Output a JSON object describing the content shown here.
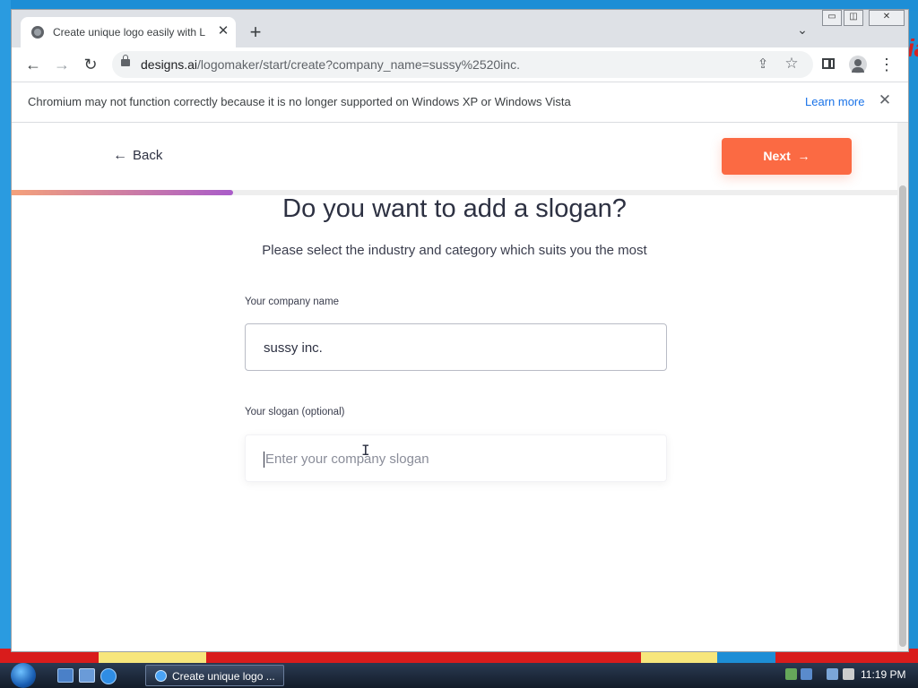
{
  "desktop": {
    "edge_text": "ia"
  },
  "browser": {
    "tab": {
      "title": "Create unique logo easily with Lo",
      "close": "✕"
    },
    "new_tab": "+",
    "tab_list": "⌄",
    "window_controls": {
      "minimize": "▭",
      "maximize": "◫",
      "close": "✕"
    },
    "nav": {
      "back": "←",
      "forward": "→",
      "reload": "↻"
    },
    "address": {
      "domain": "designs.ai",
      "path": "/logomaker/start/create?company_name=sussy%2520inc."
    },
    "menu": "⋮",
    "infobar": {
      "message": "Chromium may not function correctly because it is no longer supported on Windows XP or Windows Vista",
      "learn_more": "Learn more",
      "close": "✕"
    }
  },
  "page": {
    "back_label": "Back",
    "next_label": "Next",
    "progress": 0.25,
    "heading": "Do you want to add a slogan?",
    "subheading": "Please select the industry and category which suits you the most",
    "company_label": "Your company name",
    "company_value": "sussy inc.",
    "slogan_label": "Your slogan (optional)",
    "slogan_placeholder": "Enter your company slogan"
  },
  "taskbar": {
    "task_label": "Create unique logo ...",
    "clock": "11:19 PM"
  },
  "colors": {
    "accent": "#fb6a43",
    "text": "#2d3142",
    "link": "#1a73e8"
  }
}
